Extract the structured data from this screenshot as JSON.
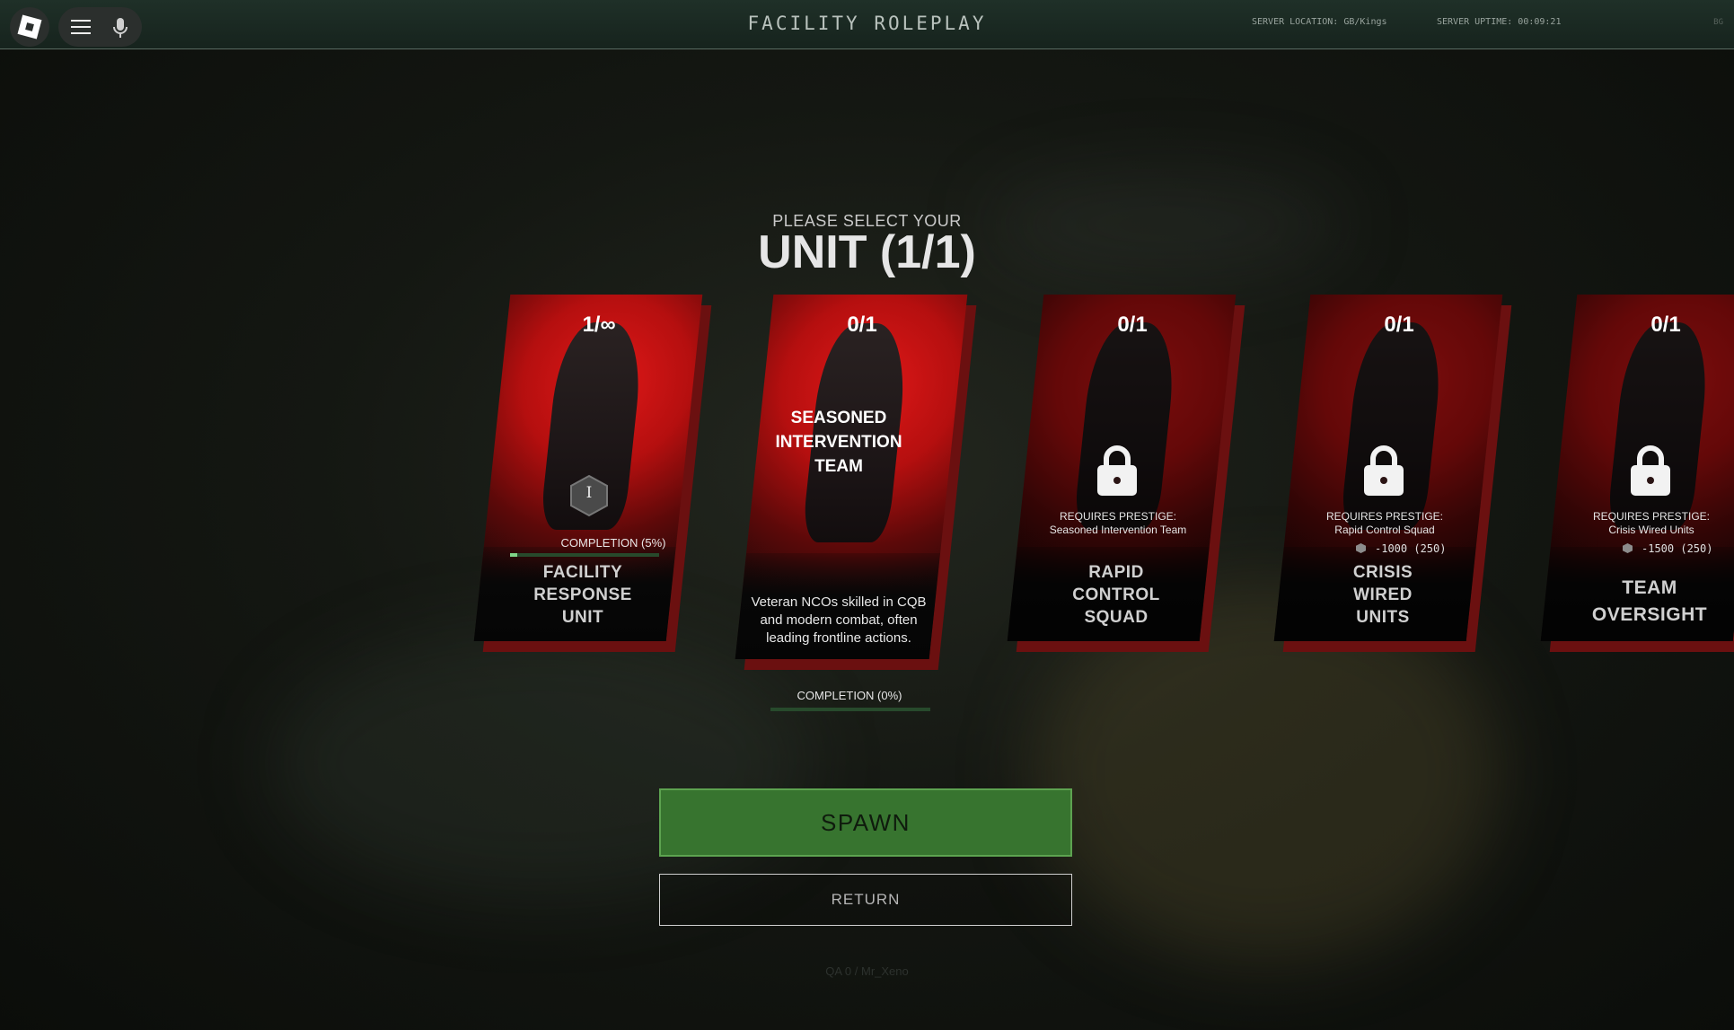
{
  "topbar": {
    "title": "FACILITY ROLEPLAY",
    "server_location": "SERVER LOCATION: GB/Kings",
    "server_uptime": "SERVER UPTIME: 00:09:21",
    "corner": "BG"
  },
  "header": {
    "subtitle": "PLEASE SELECT YOUR",
    "title": "UNIT (1/1)"
  },
  "units": [
    {
      "count": "1/∞",
      "name_lines": [
        "FACILITY",
        "RESPONSE",
        "UNIT"
      ],
      "rank_badge": "I",
      "completion_label": "COMPLETION (5%)",
      "completion": 0.05
    },
    {
      "count": "0/1",
      "name_lines": [
        "SEASONED",
        "INTERVENTION",
        "TEAM"
      ],
      "description_lines": [
        "Veteran NCOs skilled in CQB",
        "and modern combat, often",
        "leading frontline actions."
      ],
      "completion_label": "COMPLETION (0%)",
      "completion": 0.0
    },
    {
      "count": "0/1",
      "name_lines": [
        "RAPID",
        "CONTROL",
        "SQUAD"
      ],
      "requires_label": "REQUIRES  PRESTIGE:",
      "requires_value": "Seasoned Intervention Team"
    },
    {
      "count": "0/1",
      "name_lines": [
        "CRISIS",
        "WIRED",
        "UNITS"
      ],
      "requires_label": "REQUIRES  PRESTIGE:",
      "requires_value": "Rapid Control Squad",
      "cost": "-1000 (250)"
    },
    {
      "count": "0/1",
      "name_lines": [
        "TEAM",
        "OVERSIGHT"
      ],
      "requires_label": "REQUIRES  PRESTIGE:",
      "requires_value": "Crisis Wired Units",
      "cost": "-1500 (250)"
    }
  ],
  "buttons": {
    "spawn": "SPAWN",
    "return": "RETURN"
  },
  "credit": "QA 0 / Mr_Xeno",
  "colors": {
    "accent_green": "#37742f",
    "card_red": "#b50f0f",
    "progress_fill": "#7fd488"
  }
}
